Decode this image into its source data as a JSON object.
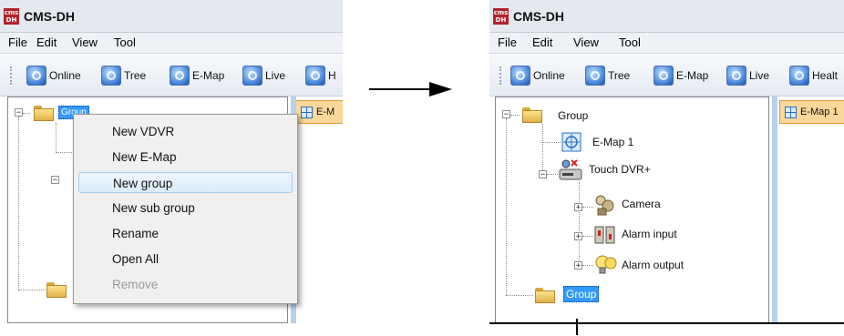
{
  "left": {
    "app": {
      "title": "CMS-DH",
      "logo_text": "cms\nDH"
    },
    "menu": [
      "File",
      "Edit",
      "View",
      "Tool"
    ],
    "toolbar": [
      {
        "label": "Online",
        "icon": "online-icon"
      },
      {
        "label": "Tree",
        "icon": "tree-icon"
      },
      {
        "label": "E-Map",
        "icon": "emap-icon"
      },
      {
        "label": "Live",
        "icon": "live-icon"
      },
      {
        "label": "H",
        "icon": "health-icon"
      }
    ],
    "tab_label": "E-M",
    "tree": {
      "group_label": "Group"
    },
    "context_menu": {
      "items": [
        "New VDVR",
        "New E-Map",
        "New group",
        "New sub group",
        "Rename",
        "Open All",
        "Remove"
      ],
      "highlighted": "New group",
      "disabled": "Remove"
    }
  },
  "right": {
    "app": {
      "title": "CMS-DH",
      "logo_text": "cms\nDH"
    },
    "menu": [
      "File",
      "Edit",
      "View",
      "Tool"
    ],
    "toolbar": [
      {
        "label": "Online",
        "icon": "online-icon"
      },
      {
        "label": "Tree",
        "icon": "tree-icon"
      },
      {
        "label": "E-Map",
        "icon": "emap-icon"
      },
      {
        "label": "Live",
        "icon": "live-icon"
      },
      {
        "label": "Healt",
        "icon": "health-icon"
      }
    ],
    "tab_label": "E-Map 1",
    "tree": {
      "group_label": "Group",
      "emap_label": "E-Map 1",
      "dvr_label": "Touch DVR+",
      "camera_label": "Camera",
      "alarm_input_label": "Alarm input",
      "alarm_output_label": "Alarm output",
      "new_group_label": "Group"
    }
  },
  "colors": {
    "selection": "#3399ff",
    "tab_background": "#fbd79a",
    "titlebar": "#e4e9f0",
    "menu_highlight": "#dcebfc"
  }
}
